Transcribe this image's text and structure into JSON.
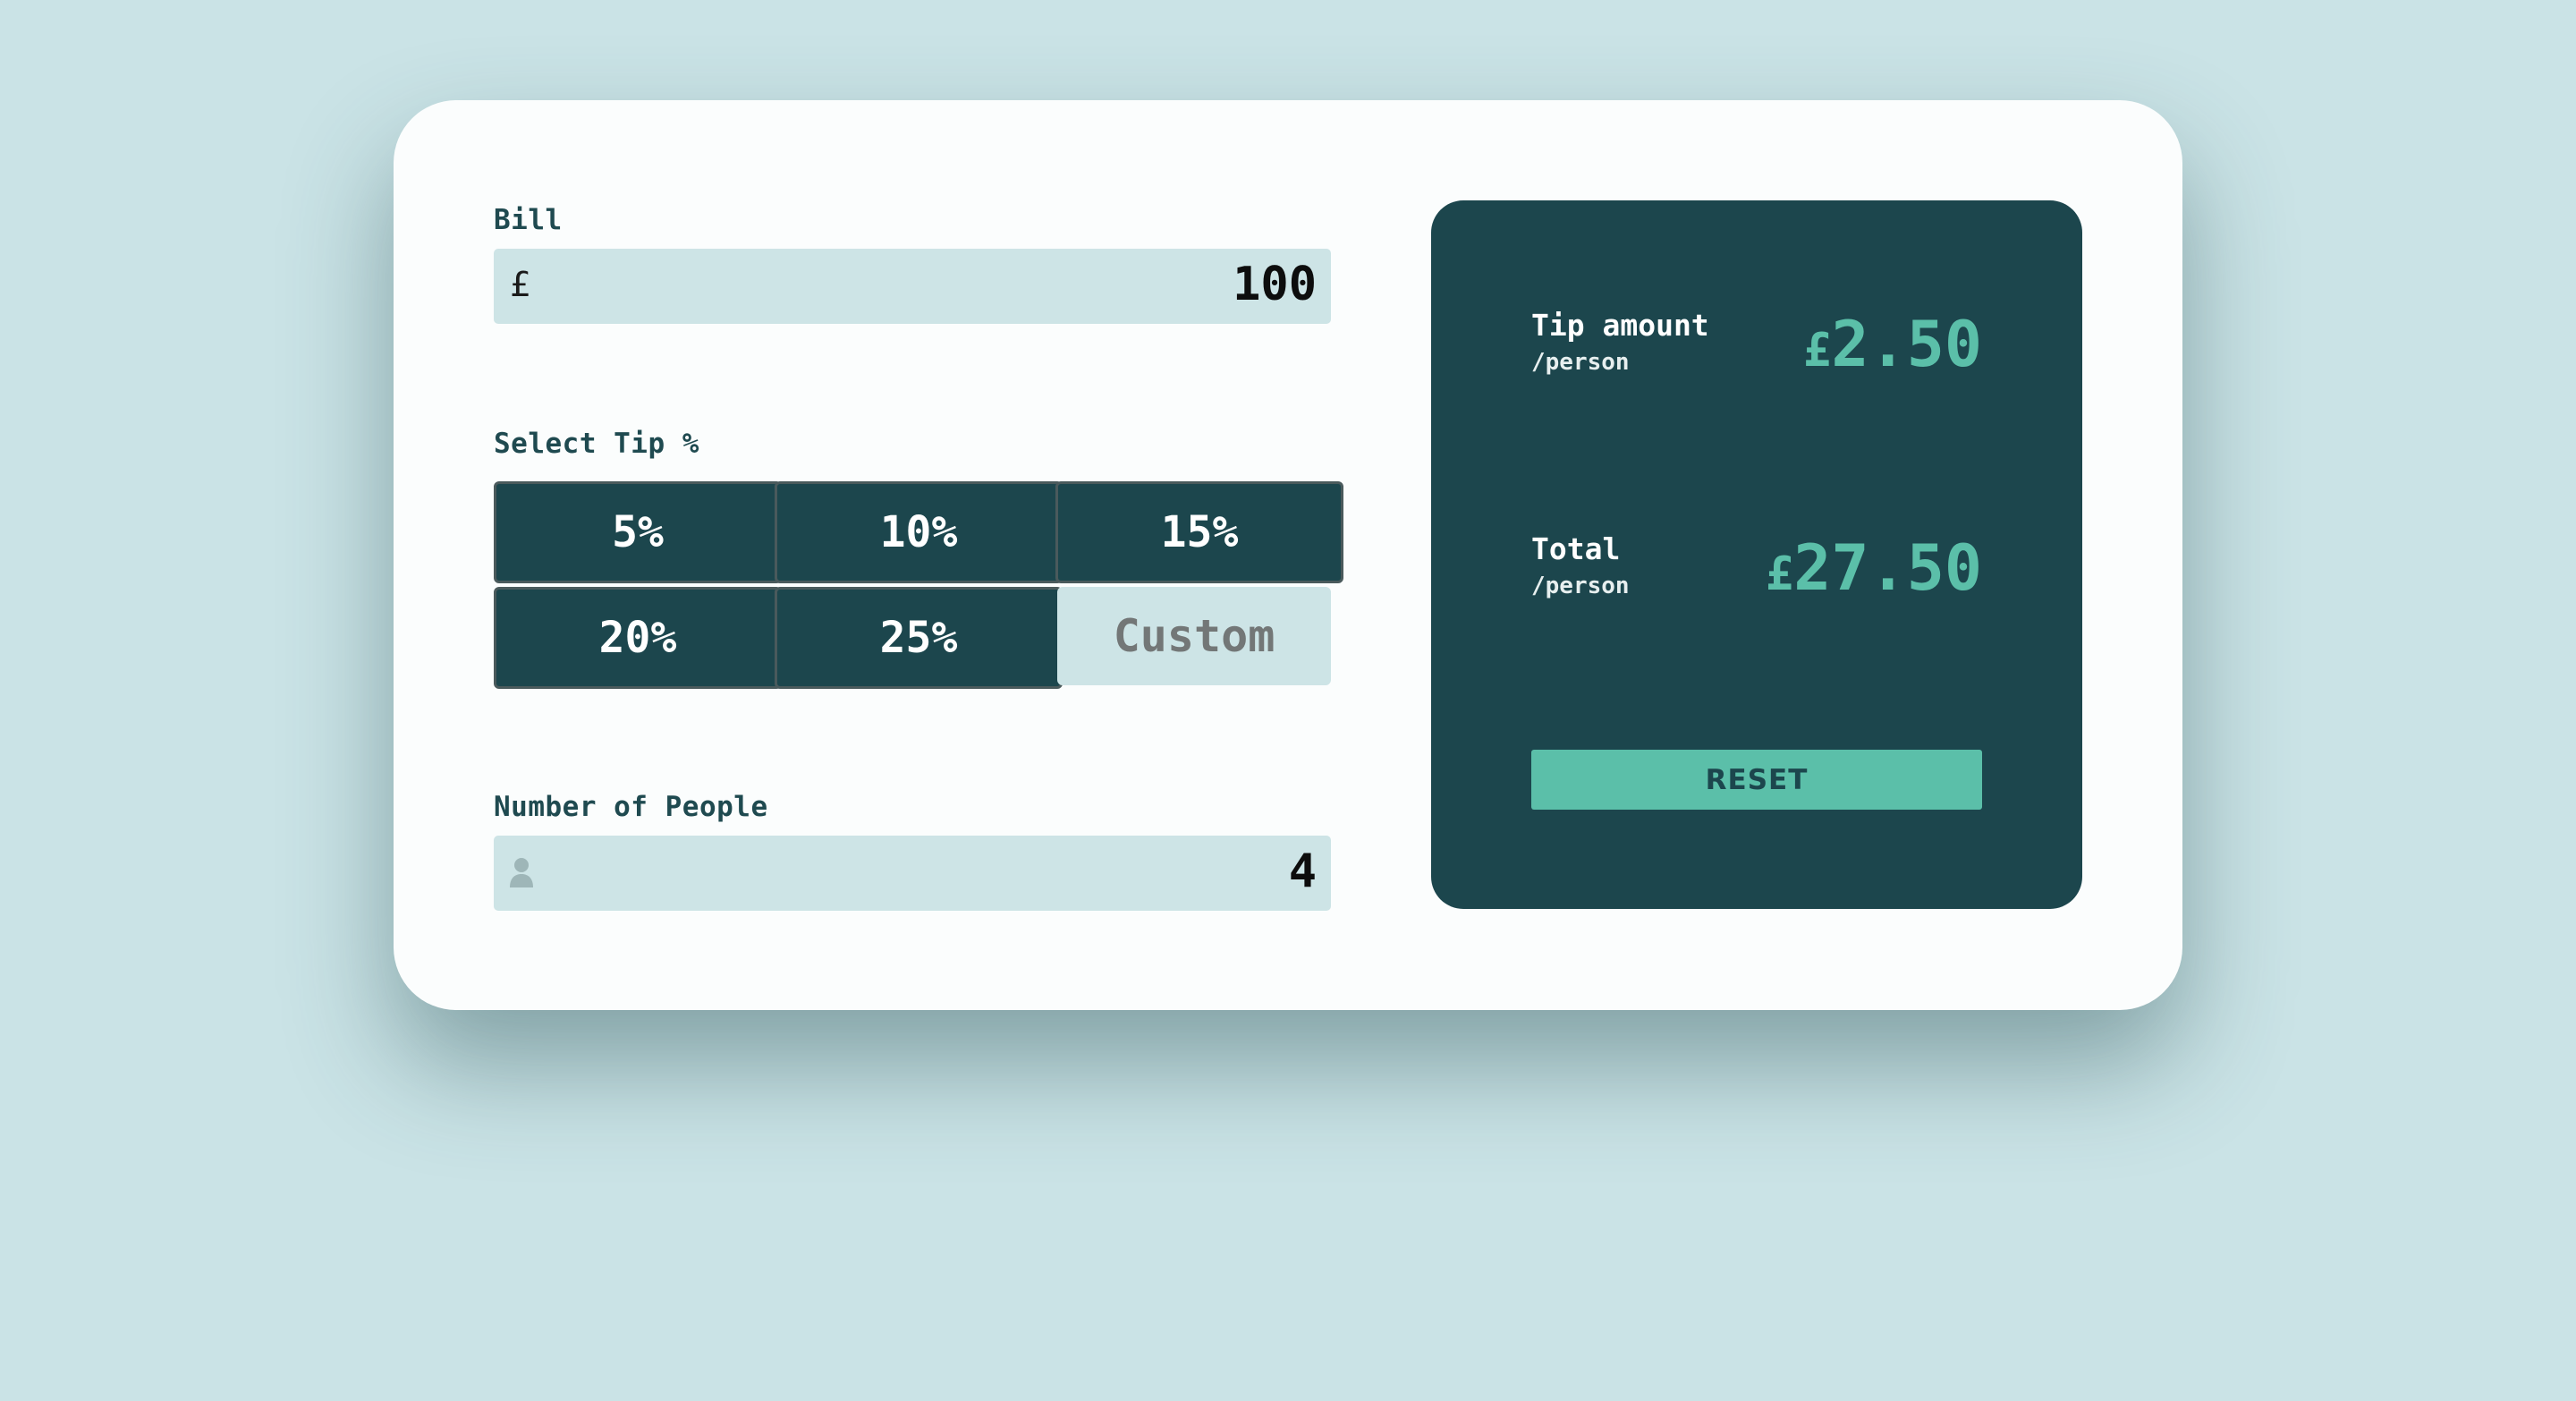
{
  "bill": {
    "label": "Bill",
    "currency_symbol": "£",
    "value": "100"
  },
  "tip": {
    "label": "Select Tip %",
    "options": [
      {
        "label": "5%"
      },
      {
        "label": "10%"
      },
      {
        "label": "15%"
      },
      {
        "label": "20%"
      },
      {
        "label": "25%"
      }
    ],
    "custom_placeholder": "Custom"
  },
  "people": {
    "label": "Number of People",
    "value": "4",
    "icon": "person-icon"
  },
  "results": {
    "tip_amount": {
      "title": "Tip amount",
      "sub": "/person",
      "currency": "£",
      "value": "2.50"
    },
    "total": {
      "title": "Total",
      "sub": "/person",
      "currency": "£",
      "value": "27.50"
    },
    "reset_label": "RESET"
  },
  "colors": {
    "background": "#cae3e6",
    "card": "#fbfdfd",
    "dark": "#1c464d",
    "accent": "#5bbfa9",
    "input_bg": "#cde4e6"
  }
}
